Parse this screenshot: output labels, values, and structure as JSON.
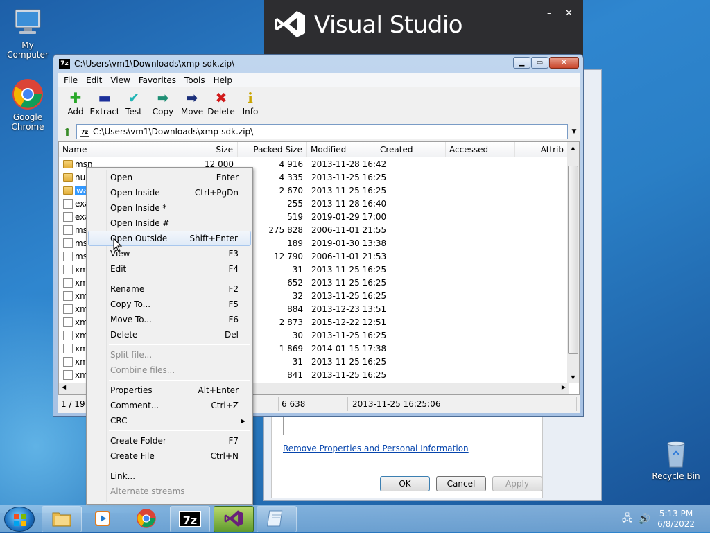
{
  "desktop": {
    "icons": [
      {
        "label": "My Computer"
      },
      {
        "label": "Google Chrome"
      },
      {
        "label": "Recycle Bin"
      }
    ]
  },
  "vs_splash": {
    "title": "Visual Studio",
    "minimize": "–",
    "close": "✕"
  },
  "props_dialog": {
    "link": "Remove Properties and Personal Information",
    "ok": "OK",
    "cancel": "Cancel",
    "apply": "Apply"
  },
  "zip": {
    "title": "C:\\Users\\vm1\\Downloads\\xmp-sdk.zip\\",
    "menu": [
      "File",
      "Edit",
      "View",
      "Favorites",
      "Tools",
      "Help"
    ],
    "toolbar": [
      {
        "label": "Add",
        "icon": "plus-icon",
        "glyph": "✚",
        "color": "#2aa82a"
      },
      {
        "label": "Extract",
        "icon": "minus-icon",
        "glyph": "▬",
        "color": "#1b2f9a"
      },
      {
        "label": "Test",
        "icon": "check-icon",
        "glyph": "✔",
        "color": "#22b5b5"
      },
      {
        "label": "Copy",
        "icon": "copy-arrow-icon",
        "glyph": "➡",
        "color": "#1f8f74"
      },
      {
        "label": "Move",
        "icon": "move-arrow-icon",
        "glyph": "➡",
        "color": "#1b2f7a"
      },
      {
        "label": "Delete",
        "icon": "delete-x-icon",
        "glyph": "✖",
        "color": "#d11a1a"
      },
      {
        "label": "Info",
        "icon": "info-icon",
        "glyph": "i",
        "color": "#c9a400"
      }
    ],
    "address": "C:\\Users\\vm1\\Downloads\\xmp-sdk.zip\\",
    "columns": [
      "Name",
      "Size",
      "Packed Size",
      "Modified",
      "Created",
      "Accessed",
      "Attrib"
    ],
    "rows": [
      {
        "name": "msn",
        "type": "folder",
        "size": "12 000",
        "packed": "4 916",
        "modified": "2013-11-28 16:42"
      },
      {
        "name": "nul",
        "type": "folder",
        "size": "",
        "packed": "4 335",
        "modified": "2013-11-25 16:25"
      },
      {
        "name": "wa",
        "type": "folder",
        "size": "",
        "packed": "2 670",
        "modified": "2013-11-25 16:25",
        "selected": true
      },
      {
        "name": "exa",
        "type": "file",
        "size": "",
        "packed": "255",
        "modified": "2013-11-28 16:40"
      },
      {
        "name": "exa",
        "type": "file",
        "size": "",
        "packed": "519",
        "modified": "2019-01-29 17:00"
      },
      {
        "name": "ms",
        "type": "file",
        "size": "",
        "packed": "275 828",
        "modified": "2006-11-01 21:55"
      },
      {
        "name": "ms",
        "type": "file",
        "size": "",
        "packed": "189",
        "modified": "2019-01-30 13:38"
      },
      {
        "name": "ms",
        "type": "file",
        "size": "",
        "packed": "12 790",
        "modified": "2006-11-01 21:53"
      },
      {
        "name": "xm",
        "type": "file",
        "size": "",
        "packed": "31",
        "modified": "2013-11-25 16:25"
      },
      {
        "name": "xm",
        "type": "file",
        "size": "",
        "packed": "652",
        "modified": "2013-11-25 16:25"
      },
      {
        "name": "xm",
        "type": "file",
        "size": "",
        "packed": "32",
        "modified": "2013-11-25 16:25"
      },
      {
        "name": "xm",
        "type": "file",
        "size": "",
        "packed": "884",
        "modified": "2013-12-23 13:51"
      },
      {
        "name": "xm",
        "type": "file",
        "size": "",
        "packed": "2 873",
        "modified": "2015-12-22 12:51"
      },
      {
        "name": "xm",
        "type": "file",
        "size": "",
        "packed": "30",
        "modified": "2013-11-25 16:25"
      },
      {
        "name": "xm",
        "type": "file",
        "size": "",
        "packed": "1 869",
        "modified": "2014-01-15 17:38"
      },
      {
        "name": "xm",
        "type": "file",
        "size": "",
        "packed": "31",
        "modified": "2013-11-25 16:25"
      },
      {
        "name": "xm",
        "type": "file",
        "size": "",
        "packed": "841",
        "modified": "2013-11-25 16:25"
      }
    ],
    "status": {
      "selection": "1 / 19 o",
      "packed": "6 638",
      "modified": "2013-11-25 16:25:06"
    }
  },
  "context_menu": {
    "groups": [
      [
        {
          "label": "Open",
          "shortcut": "Enter"
        },
        {
          "label": "Open Inside",
          "shortcut": "Ctrl+PgDn"
        },
        {
          "label": "Open Inside *",
          "shortcut": ""
        },
        {
          "label": "Open Inside #",
          "shortcut": ""
        },
        {
          "label": "Open Outside",
          "shortcut": "Shift+Enter",
          "highlighted": true
        },
        {
          "label": "View",
          "shortcut": "F3"
        },
        {
          "label": "Edit",
          "shortcut": "F4"
        }
      ],
      [
        {
          "label": "Rename",
          "shortcut": "F2"
        },
        {
          "label": "Copy To...",
          "shortcut": "F5"
        },
        {
          "label": "Move To...",
          "shortcut": "F6"
        },
        {
          "label": "Delete",
          "shortcut": "Del"
        }
      ],
      [
        {
          "label": "Split file...",
          "shortcut": "",
          "disabled": true
        },
        {
          "label": "Combine files...",
          "shortcut": "",
          "disabled": true
        }
      ],
      [
        {
          "label": "Properties",
          "shortcut": "Alt+Enter"
        },
        {
          "label": "Comment...",
          "shortcut": "Ctrl+Z"
        },
        {
          "label": "CRC",
          "shortcut": "",
          "submenu": true
        }
      ],
      [
        {
          "label": "Create Folder",
          "shortcut": "F7"
        },
        {
          "label": "Create File",
          "shortcut": "Ctrl+N"
        }
      ],
      [
        {
          "label": "Link...",
          "shortcut": ""
        },
        {
          "label": "Alternate streams",
          "shortcut": "",
          "disabled": true
        }
      ]
    ]
  },
  "taskbar": {
    "items": [
      "explorer",
      "media-player",
      "chrome",
      "7zip",
      "visual-studio",
      "notepad"
    ],
    "time": "5:13 PM",
    "date": "6/8/2022"
  }
}
